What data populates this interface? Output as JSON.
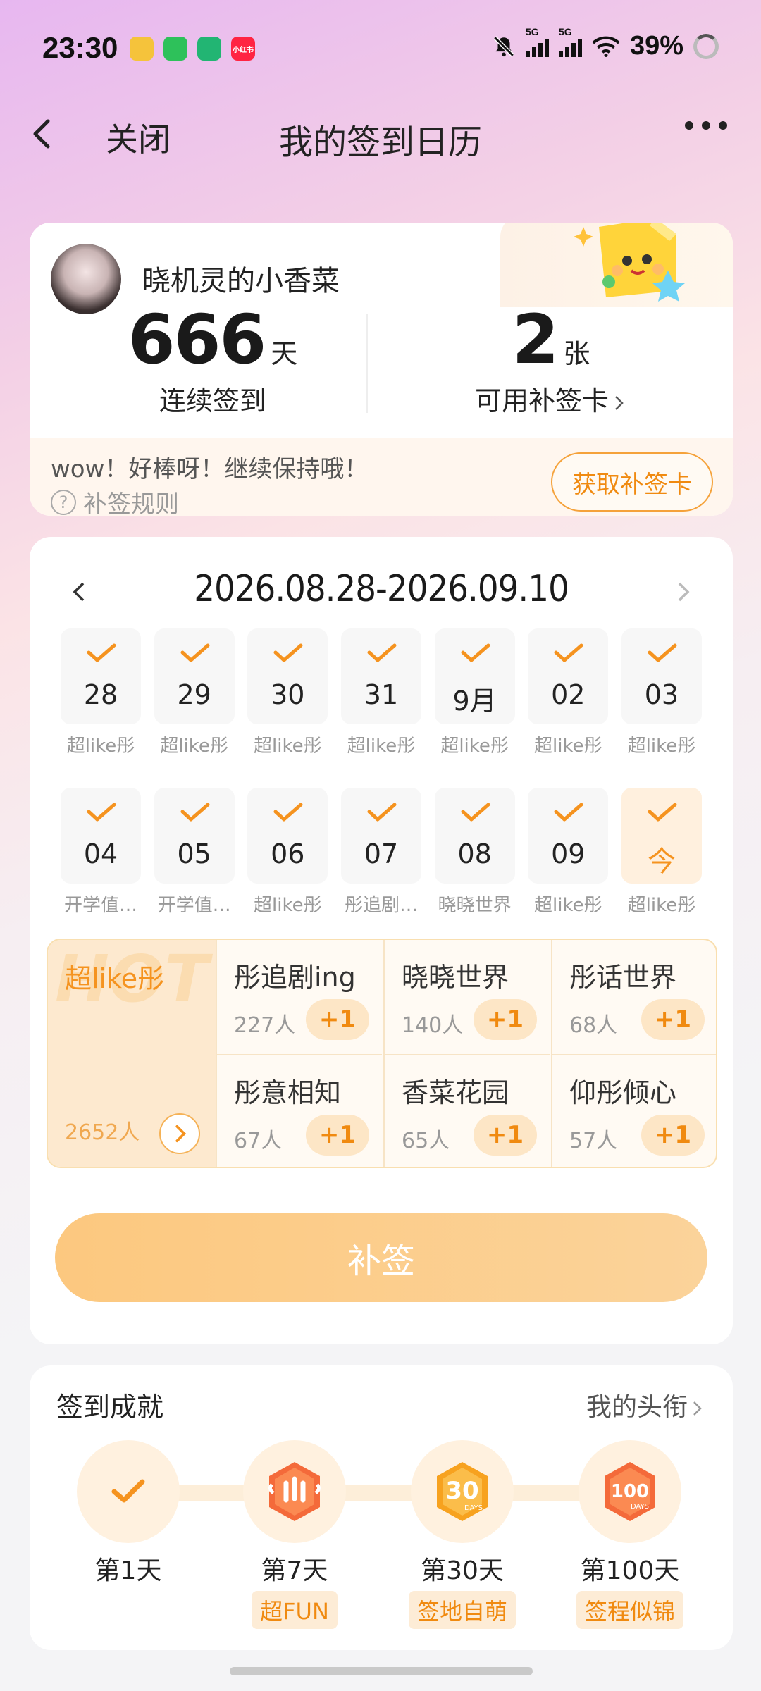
{
  "status_bar": {
    "time": "23:30",
    "apps": [
      {
        "name": "weibo-icon",
        "color": "#f5c33b",
        "text": ""
      },
      {
        "name": "wechat-icon",
        "color": "#2ec15a",
        "text": ""
      },
      {
        "name": "camera-app-icon",
        "color": "#22b573",
        "text": ""
      },
      {
        "name": "xiaohongshu-icon",
        "color": "#ff2442",
        "text": "小红书"
      }
    ],
    "signal_label_1": "5G",
    "signal_label_2": "5G",
    "battery": "39%"
  },
  "nav": {
    "close_label": "关闭",
    "title": "我的签到日历"
  },
  "user": {
    "name": "晓机灵的小香菜",
    "streak_value": "666",
    "streak_unit": "天",
    "streak_label": "连续签到",
    "cards_value": "2",
    "cards_unit": "张",
    "cards_label": "可用补签卡",
    "message": "wow！好棒呀！继续保持哦！",
    "rules_label": "补签规则",
    "get_card_button": "获取补签卡"
  },
  "calendar": {
    "range": "2026.08.28-2026.09.10",
    "week1": [
      {
        "num": "28",
        "label": "超like彤",
        "today": false
      },
      {
        "num": "29",
        "label": "超like彤",
        "today": false
      },
      {
        "num": "30",
        "label": "超like彤",
        "today": false
      },
      {
        "num": "31",
        "label": "超like彤",
        "today": false
      },
      {
        "num": "9月",
        "label": "超like彤",
        "today": false
      },
      {
        "num": "02",
        "label": "超like彤",
        "today": false
      },
      {
        "num": "03",
        "label": "超like彤",
        "today": false
      }
    ],
    "week2": [
      {
        "num": "04",
        "label": "开学值…",
        "today": false
      },
      {
        "num": "05",
        "label": "开学值…",
        "today": false
      },
      {
        "num": "06",
        "label": "超like彤",
        "today": false
      },
      {
        "num": "07",
        "label": "彤追剧…",
        "today": false
      },
      {
        "num": "08",
        "label": "晓晓世界",
        "today": false
      },
      {
        "num": "09",
        "label": "超like彤",
        "today": false
      },
      {
        "num": "今",
        "label": "超like彤",
        "today": true
      }
    ]
  },
  "hot": {
    "bg_text": "HOT",
    "main_title": "超like彤",
    "main_count": "2652人",
    "cells": [
      {
        "name": "彤追剧ing",
        "count": "227人",
        "plus": "+1"
      },
      {
        "name": "晓晓世界",
        "count": "140人",
        "plus": "+1"
      },
      {
        "name": "彤话世界",
        "count": "68人",
        "plus": "+1"
      },
      {
        "name": "彤意相知",
        "count": "67人",
        "plus": "+1"
      },
      {
        "name": "香菜花园",
        "count": "65人",
        "plus": "+1"
      },
      {
        "name": "仰彤倾心",
        "count": "57人",
        "plus": "+1"
      }
    ]
  },
  "makeup_button": "补签",
  "achievements": {
    "title": "签到成就",
    "link": "我的头衔",
    "items": [
      {
        "day": "第1天",
        "tag": "",
        "badge": "check"
      },
      {
        "day": "第7天",
        "tag": "超FUN",
        "badge": "hand"
      },
      {
        "day": "第30天",
        "tag": "签地自萌",
        "badge": "30"
      },
      {
        "day": "第100天",
        "tag": "签程似锦",
        "badge": "100"
      }
    ],
    "badge_30_text": "30",
    "badge_100_text": "100",
    "badge_days_text": "DAYS"
  },
  "colors": {
    "accent": "#f5931f",
    "accent_light": "#fde6c6"
  }
}
